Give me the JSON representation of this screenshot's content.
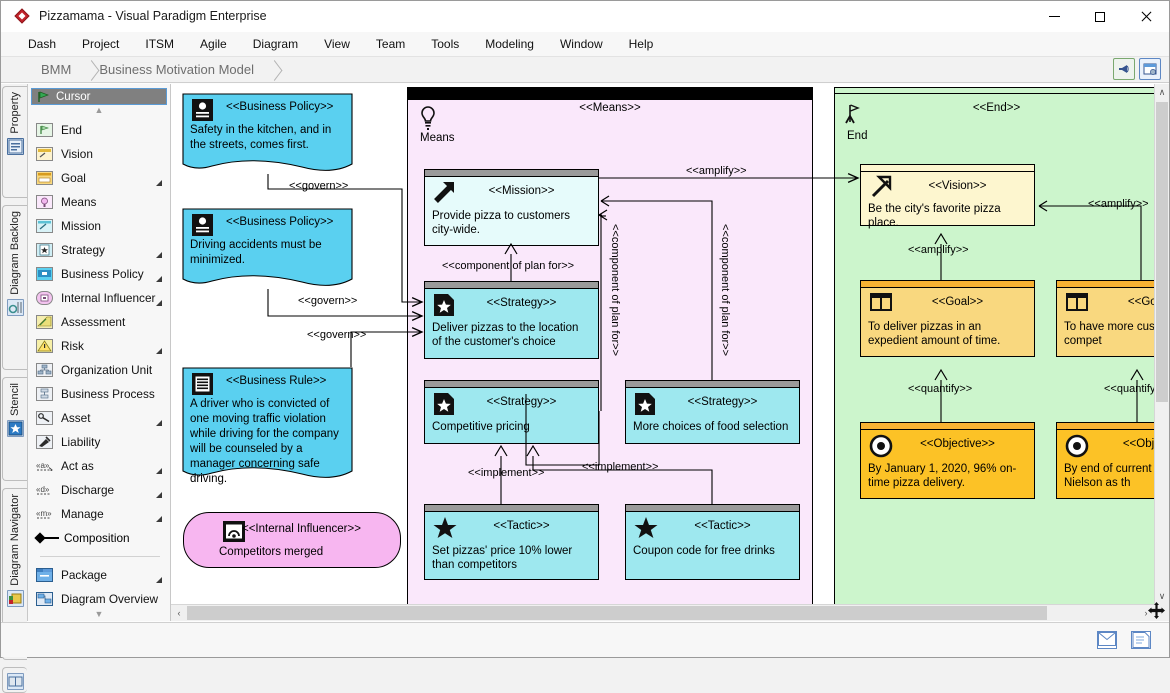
{
  "window": {
    "title": "Pizzamama - Visual Paradigm Enterprise",
    "app_icon": "diamond-logo-icon",
    "minimize_label": "–",
    "maximize_label": "□",
    "close_label": "✕"
  },
  "menu": {
    "items": [
      "Dash",
      "Project",
      "ITSM",
      "Agile",
      "Diagram",
      "View",
      "Team",
      "Tools",
      "Modeling",
      "Window",
      "Help"
    ]
  },
  "breadcrumb": {
    "items": [
      "BMM",
      "Business Motivation Model"
    ],
    "tools": [
      {
        "name": "announcement-icon",
        "label": ""
      },
      {
        "name": "diagram-settings-icon",
        "label": ""
      }
    ]
  },
  "vertical_tabs": [
    {
      "label": "Property",
      "icon": "property-icon"
    },
    {
      "label": "Diagram Backlog",
      "icon": "backlog-icon"
    },
    {
      "label": "Stencil",
      "icon": "stencil-icon"
    },
    {
      "label": "Diagram Navigator",
      "icon": "navigator-icon"
    },
    {
      "label": "",
      "icon": "model-explorer-icon"
    }
  ],
  "palette": {
    "cursor_label": "Cursor",
    "cursor_icon": "cursor-flag-icon",
    "scroll_up": "▲",
    "scroll_down": "▼",
    "items": [
      {
        "label": "End",
        "icon": "end-icon",
        "expandable": false
      },
      {
        "label": "Vision",
        "icon": "vision-icon",
        "expandable": false
      },
      {
        "label": "Goal",
        "icon": "goal-icon",
        "expandable": true
      },
      {
        "label": "Means",
        "icon": "means-icon",
        "expandable": false
      },
      {
        "label": "Mission",
        "icon": "mission-icon",
        "expandable": false
      },
      {
        "label": "Strategy",
        "icon": "strategy-icon",
        "expandable": true
      },
      {
        "label": "Business Policy",
        "icon": "business-policy-icon",
        "expandable": true
      },
      {
        "label": "Internal Influencer",
        "icon": "internal-influencer-icon",
        "expandable": true
      },
      {
        "label": "Assessment",
        "icon": "assessment-icon",
        "expandable": false
      },
      {
        "label": "Risk",
        "icon": "risk-icon",
        "expandable": true
      },
      {
        "label": "Organization Unit",
        "icon": "organization-unit-icon",
        "expandable": false
      },
      {
        "label": "Business Process",
        "icon": "business-process-icon",
        "expandable": false
      },
      {
        "label": "Asset",
        "icon": "asset-icon",
        "expandable": true
      },
      {
        "label": "Liability",
        "icon": "liability-icon",
        "expandable": false
      },
      {
        "label": "Act as",
        "icon": "act-as-icon",
        "expandable": true
      },
      {
        "label": "Discharge",
        "icon": "discharge-icon",
        "expandable": true
      },
      {
        "label": "Manage",
        "icon": "manage-icon",
        "expandable": true
      }
    ],
    "composition": {
      "label": "Composition",
      "icon": "composition-icon"
    },
    "bottom_items": [
      {
        "label": "Package",
        "icon": "package-icon",
        "expandable": true
      },
      {
        "label": "Diagram Overview",
        "icon": "diagram-overview-icon",
        "expandable": false
      }
    ]
  },
  "diagram": {
    "policies": [
      {
        "stereotype": "<<Business Policy>>",
        "text": "Safety in the kitchen, and in the streets, comes first.",
        "icon": "business-policy-node-icon"
      },
      {
        "stereotype": "<<Business Policy>>",
        "text": "Driving accidents must be minimized.",
        "icon": "business-policy-node-icon"
      },
      {
        "stereotype": "<<Business Rule>>",
        "text": "A driver who is convicted of one moving traffic violation while driving for the company will be counseled by a manager concerning safe driving.",
        "icon": "business-rule-node-icon"
      }
    ],
    "influencer": {
      "stereotype": "<<Internal Influencer>>",
      "text": "Competitors merged",
      "icon": "internal-influencer-node-icon"
    },
    "means_group": {
      "stereotype": "<<Means>>",
      "name": "Means",
      "icon": "means-bulb-icon"
    },
    "end_group": {
      "stereotype": "<<End>>",
      "name": "End",
      "icon": "end-flag-icon"
    },
    "nodes": [
      {
        "id": "mission",
        "stereotype": "<<Mission>>",
        "text": "Provide pizza to customers city-wide.",
        "icon": "mission-arrow-icon"
      },
      {
        "id": "strategy1",
        "stereotype": "<<Strategy>>",
        "text": "Deliver pizzas to the location of the customer's choice",
        "icon": "strategy-doc-icon"
      },
      {
        "id": "strategy2",
        "stereotype": "<<Strategy>>",
        "text": "Competitive pricing",
        "icon": "strategy-doc-icon"
      },
      {
        "id": "strategy3",
        "stereotype": "<<Strategy>>",
        "text": "More choices of food selection",
        "icon": "strategy-doc-icon"
      },
      {
        "id": "tactic1",
        "stereotype": "<<Tactic>>",
        "text": "Set pizzas' price 10% lower than competitors",
        "icon": "tactic-star-icon"
      },
      {
        "id": "tactic2",
        "stereotype": "<<Tactic>>",
        "text": "Coupon code for free drinks",
        "icon": "tactic-star-icon"
      },
      {
        "id": "vision",
        "stereotype": "<<Vision>>",
        "text": "Be the city's favorite pizza place.",
        "icon": "vision-arrow-icon"
      },
      {
        "id": "goal1",
        "stereotype": "<<Goal>>",
        "text": "To deliver pizzas in an expedient amount of time.",
        "icon": "goal-table-icon"
      },
      {
        "id": "goal2",
        "stereotype": "<<Goal>>",
        "text": "To have more custo  any other compet",
        "icon": "goal-table-icon"
      },
      {
        "id": "objective1",
        "stereotype": "<<Objective>>",
        "text": "By January 1, 2020, 96% on-time pizza delivery.",
        "icon": "objective-target-icon"
      },
      {
        "id": "objective2",
        "stereotype": "<<Objective",
        "text": "By end of current ye  by A C Nielson as th",
        "icon": "objective-target-icon"
      }
    ],
    "edge_labels": {
      "govern1": "<<govern>>",
      "govern2": "<<govern>>",
      "govern3": "<<govern>>",
      "amplify_mission": "<<amplify>>",
      "amplify_vision": "<<amplify>>",
      "amplify_goal2": "<<amplify>>",
      "component1": "<<component of plan for>>",
      "component2": "<<component of plan for>>",
      "component3": "<<component of plan for>>",
      "implement1": "<<implement>>",
      "implement2": "<<implement>>",
      "quantify1": "<<quantify>>",
      "quantify2": "<<quantify>"
    },
    "colors": {
      "policy_fill": "#5ad0f0",
      "influencer_fill": "#f7b6f0",
      "means_fill": "#fae8fb",
      "end_fill": "#ccf5cc",
      "mission_fill": "#e6fbfb",
      "strategy_fill": "#9ee8ef",
      "tactic_fill": "#9ee8ef",
      "vision_fill": "#fdf6cf",
      "goal_fill": "#f9d87f",
      "objective_fill": "#fcc226",
      "header_gray": "#9a9a9a",
      "header_orange": "#f7b233"
    }
  },
  "scrollbars": {
    "up_arrow": "∧",
    "down_arrow": "∨",
    "left_arrow": "‹",
    "right_arrow": "›"
  },
  "statusbar": {
    "icons": [
      {
        "name": "message-icon"
      },
      {
        "name": "notes-icon"
      }
    ],
    "move_handle": "move-handle-icon"
  }
}
